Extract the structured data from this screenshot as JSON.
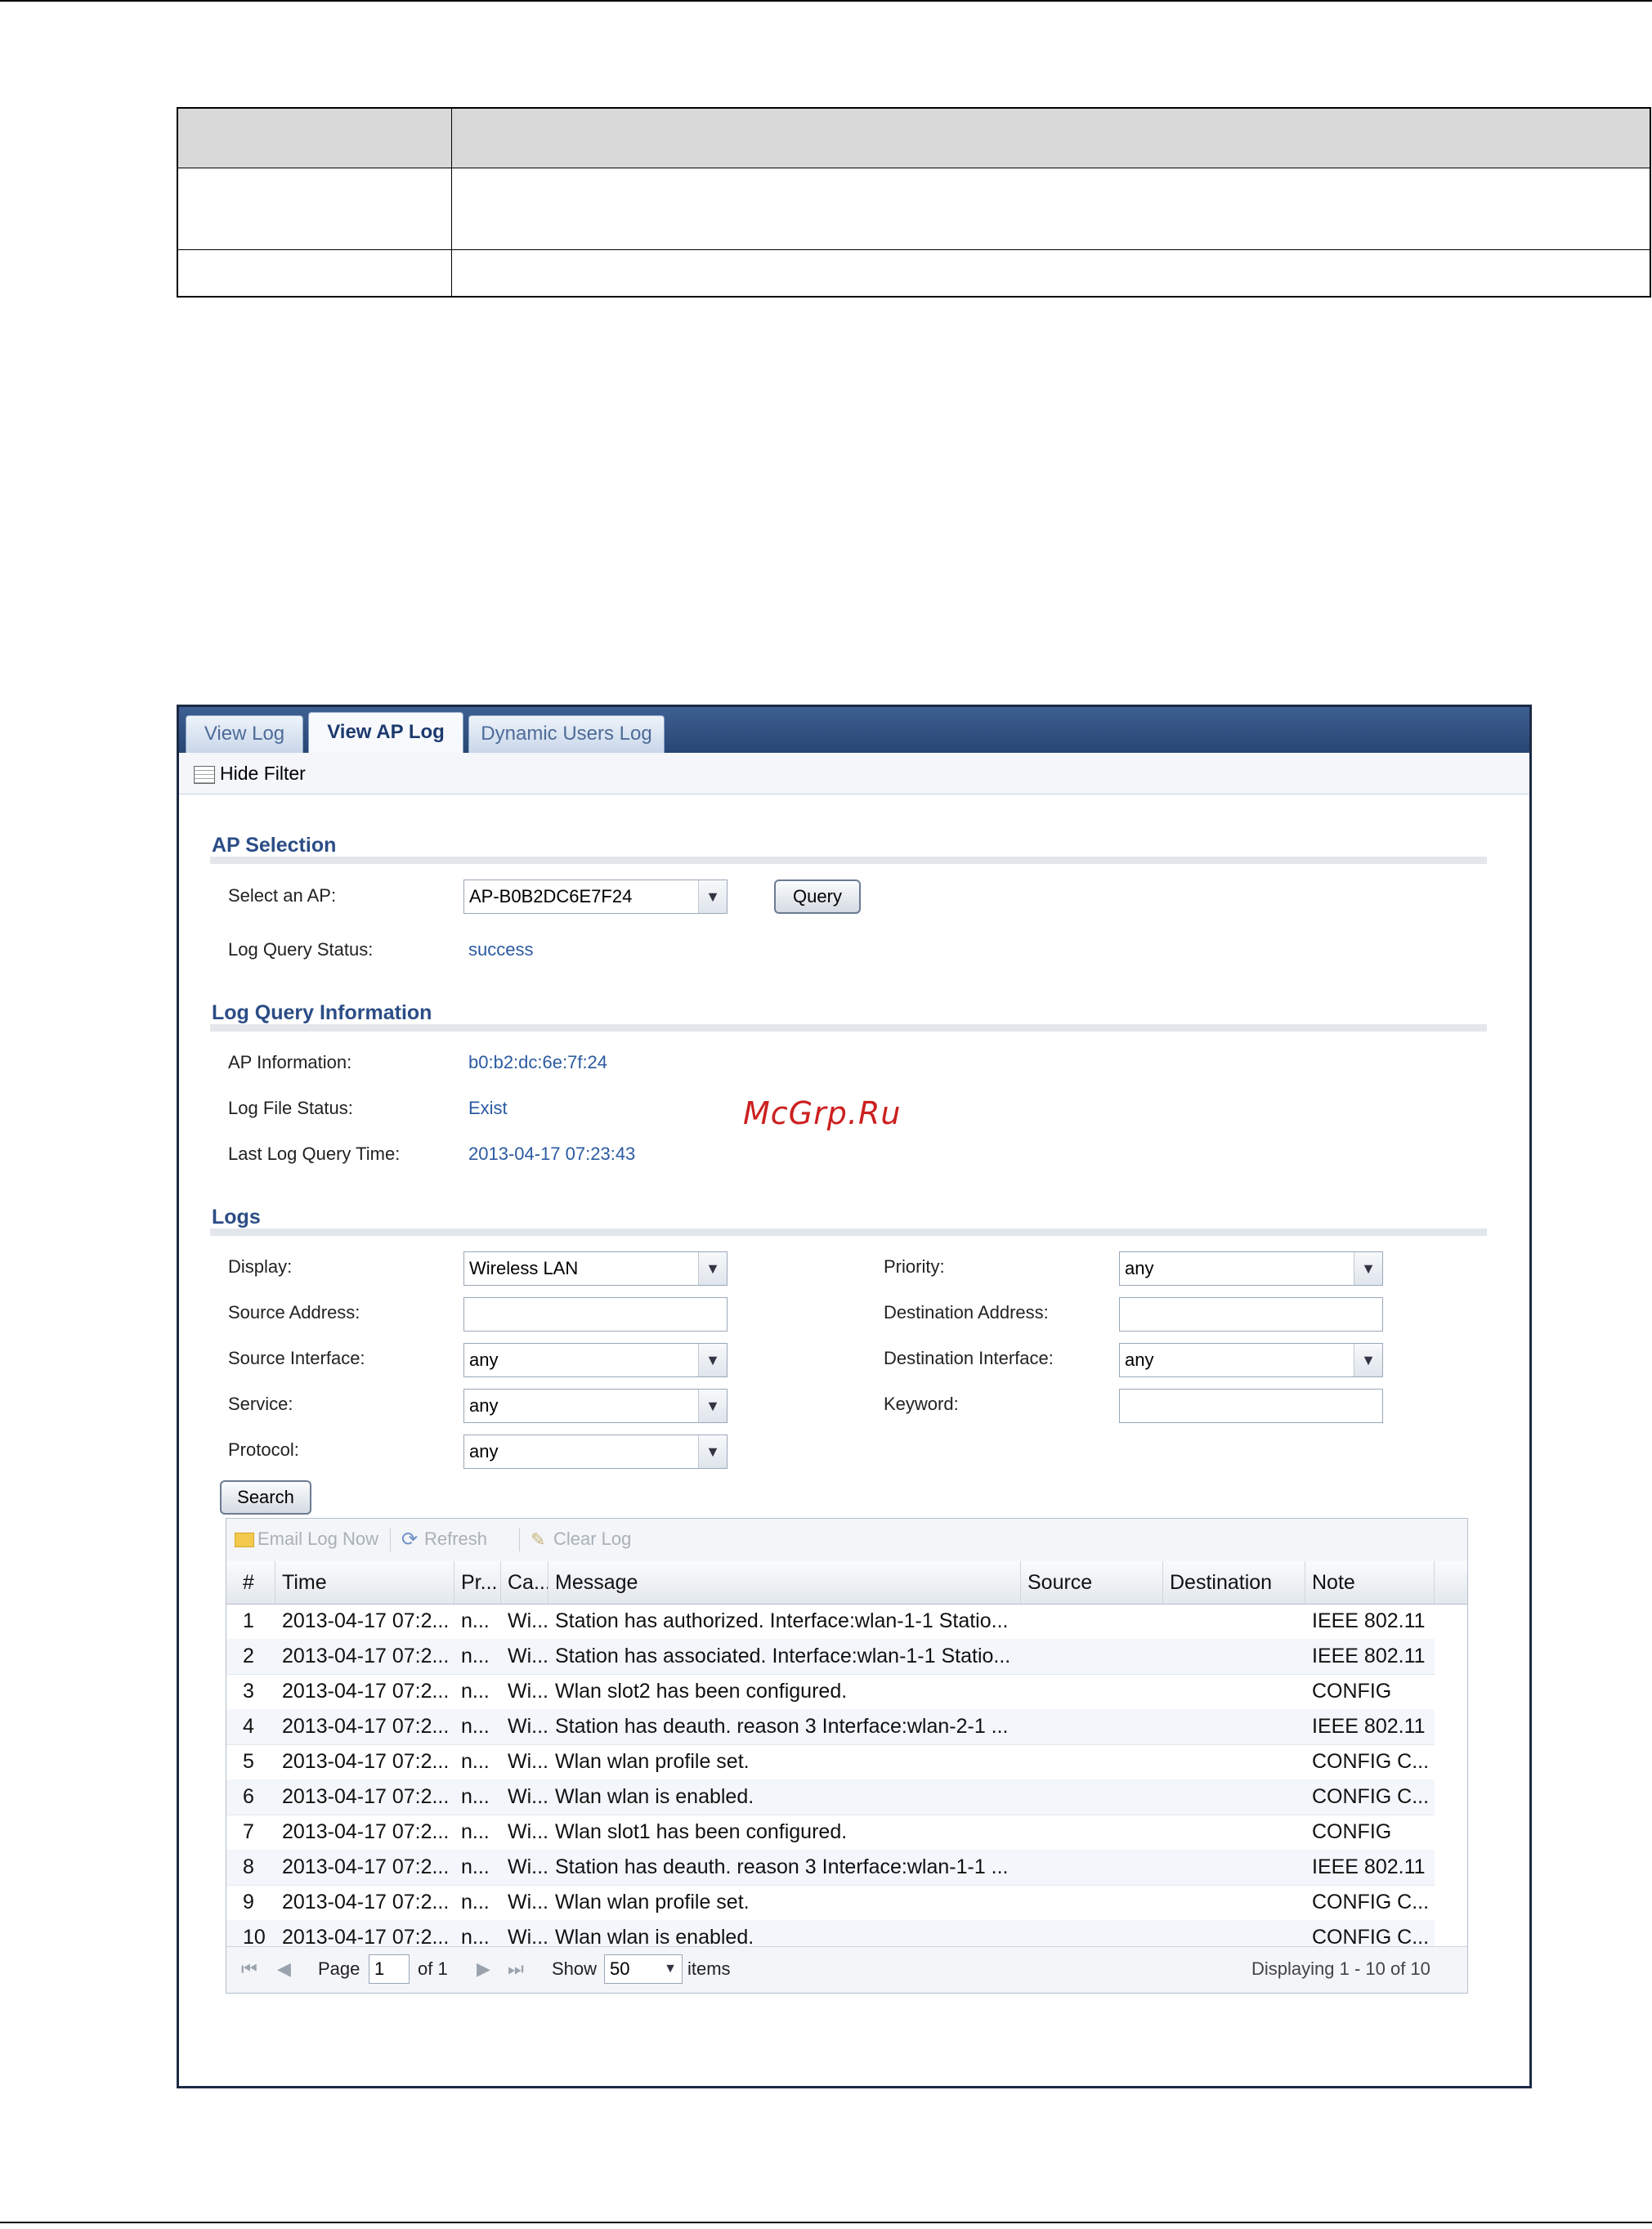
{
  "watermark": "McGrp.Ru",
  "tabs": [
    {
      "label": "View Log",
      "active": false
    },
    {
      "label": "View AP Log",
      "active": true
    },
    {
      "label": "Dynamic Users Log",
      "active": false
    }
  ],
  "hide_filter": "Hide Filter",
  "ap_selection": {
    "title": "AP Selection",
    "select_label": "Select an AP:",
    "select_value": "AP-B0B2DC6E7F24",
    "query_button": "Query",
    "status_label": "Log Query Status:",
    "status_value": "success"
  },
  "log_query_info": {
    "title": "Log Query Information",
    "ap_info_label": "AP Information:",
    "ap_info_value": "b0:b2:dc:6e:7f:24",
    "file_status_label": "Log File Status:",
    "file_status_value": "Exist",
    "last_time_label": "Last Log Query Time:",
    "last_time_value": "2013-04-17 07:23:43"
  },
  "logs": {
    "title": "Logs",
    "display_label": "Display:",
    "display_value": "Wireless LAN",
    "priority_label": "Priority:",
    "priority_value": "any",
    "src_addr_label": "Source Address:",
    "dst_addr_label": "Destination Address:",
    "src_if_label": "Source Interface:",
    "src_if_value": "any",
    "dst_if_label": "Destination Interface:",
    "dst_if_value": "any",
    "service_label": "Service:",
    "service_value": "any",
    "keyword_label": "Keyword:",
    "protocol_label": "Protocol:",
    "protocol_value": "any",
    "search_button": "Search"
  },
  "grid": {
    "tools": {
      "email": "Email Log Now",
      "refresh": "Refresh",
      "clear": "Clear Log"
    },
    "columns": [
      "#",
      "Time",
      "Pr...",
      "Ca...",
      "Message",
      "Source",
      "Destination",
      "Note"
    ],
    "rows": [
      [
        "1",
        "2013-04-17 07:2...",
        "n...",
        "Wi...",
        "Station has authorized. Interface:wlan-1-1 Statio...",
        "",
        "",
        "IEEE 802.11"
      ],
      [
        "2",
        "2013-04-17 07:2...",
        "n...",
        "Wi...",
        "Station has associated. Interface:wlan-1-1 Statio...",
        "",
        "",
        "IEEE 802.11"
      ],
      [
        "3",
        "2013-04-17 07:2...",
        "n...",
        "Wi...",
        "Wlan slot2 has been configured.",
        "",
        "",
        "CONFIG"
      ],
      [
        "4",
        "2013-04-17 07:2...",
        "n...",
        "Wi...",
        "Station has deauth. reason 3 Interface:wlan-2-1 ...",
        "",
        "",
        "IEEE 802.11"
      ],
      [
        "5",
        "2013-04-17 07:2...",
        "n...",
        "Wi...",
        "Wlan wlan profile set.",
        "",
        "",
        "CONFIG C..."
      ],
      [
        "6",
        "2013-04-17 07:2...",
        "n...",
        "Wi...",
        "Wlan wlan is enabled.",
        "",
        "",
        "CONFIG C..."
      ],
      [
        "7",
        "2013-04-17 07:2...",
        "n...",
        "Wi...",
        "Wlan slot1 has been configured.",
        "",
        "",
        "CONFIG"
      ],
      [
        "8",
        "2013-04-17 07:2...",
        "n...",
        "Wi...",
        "Station has deauth. reason 3 Interface:wlan-1-1 ...",
        "",
        "",
        "IEEE 802.11"
      ],
      [
        "9",
        "2013-04-17 07:2...",
        "n...",
        "Wi...",
        "Wlan wlan profile set.",
        "",
        "",
        "CONFIG C..."
      ],
      [
        "10",
        "2013-04-17 07:2...",
        "n...",
        "Wi...",
        "Wlan wlan is enabled.",
        "",
        "",
        "CONFIG C..."
      ]
    ],
    "footer": {
      "page_label": "Page",
      "page_value": "1",
      "of_label": "of 1",
      "show_label": "Show",
      "show_value": "50",
      "items_label": "items",
      "displaying": "Displaying 1 - 10 of 10"
    }
  }
}
